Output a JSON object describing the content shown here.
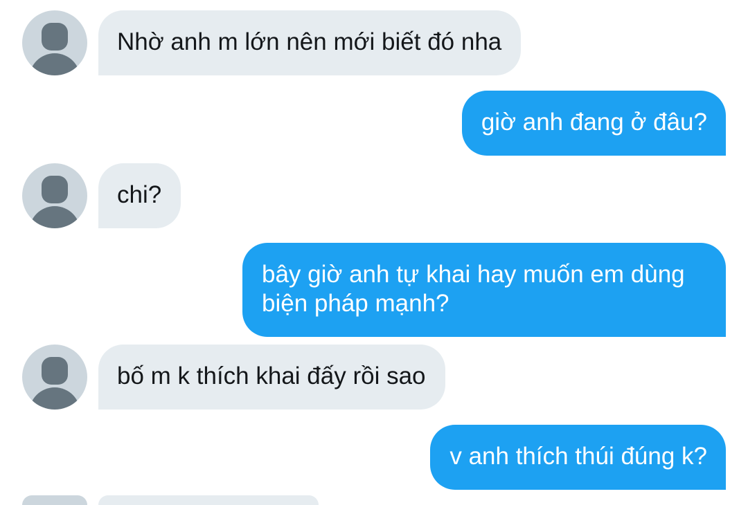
{
  "messages": [
    {
      "side": "in",
      "text": "Nhờ anh m lớn nên mới biết đó nha"
    },
    {
      "side": "out",
      "text": "giờ anh đang ở đâu?"
    },
    {
      "side": "in",
      "text": "chi?"
    },
    {
      "side": "out",
      "lines": [
        "bây giờ anh tự khai hay muốn em dùng",
        "biện pháp mạnh?"
      ]
    },
    {
      "side": "in",
      "text": "bố m k thích khai đấy rồi sao"
    },
    {
      "side": "out",
      "text": "v anh thích thúi đúng k?"
    },
    {
      "side": "in",
      "text": ""
    }
  ],
  "colors": {
    "incoming_bubble": "#e6ecf0",
    "outgoing_bubble": "#1da1f2",
    "avatar_bg": "#ccd6dd",
    "avatar_fg": "#66757f"
  },
  "icons": {
    "avatar": "default-profile-avatar-icon"
  }
}
